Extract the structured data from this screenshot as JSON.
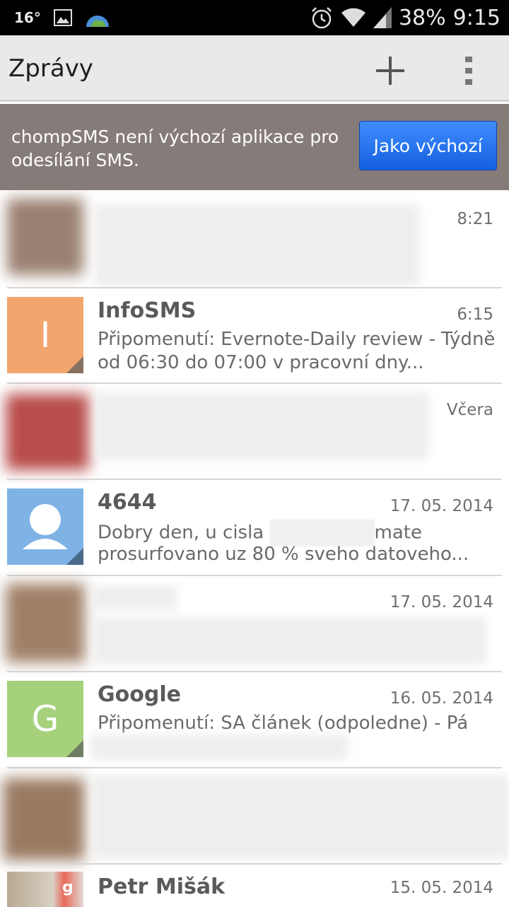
{
  "statusbar": {
    "temperature": "16°",
    "battery": "38%",
    "time": "9:15"
  },
  "actionbar": {
    "title": "Zprávy"
  },
  "banner": {
    "text": "chompSMS není výchozí aplikace pro odesílání SMS.",
    "button_label": "Jako výchozí"
  },
  "conversations": [
    {
      "name": "",
      "time": "8:21",
      "snippet": "",
      "avatar_color": "#a08070"
    },
    {
      "name": "InfoSMS",
      "time": "6:15",
      "letter": "I",
      "avatar_color": "#f2a56d",
      "snippet_line1": "Připomenutí: Evernote-Daily review - Týdně",
      "snippet_line2": "od 06:30 do 07:00 v pracovní dny..."
    },
    {
      "name": "",
      "time": "Včera",
      "snippet": "",
      "avatar_color": "#c04848"
    },
    {
      "name": "4644",
      "time": "17. 05. 2014",
      "avatar_color": "#7fb3e6",
      "snippet_line1a": "Dobry den, u cisla",
      "snippet_line1b": "mate",
      "snippet_line2": "prosurfovano uz 80 % sveho datoveho..."
    },
    {
      "name": "",
      "time": "17. 05. 2014",
      "snippet": "",
      "avatar_color": "#a0806a"
    },
    {
      "name": "Google",
      "time": "16. 05. 2014",
      "letter": "G",
      "avatar_color": "#a5d17b",
      "snippet_line1": "Připomenutí: SA článek (odpoledne) - Pá"
    },
    {
      "name": "",
      "time": "",
      "snippet": "",
      "avatar_color": "#9a7a62"
    },
    {
      "name": "Petr Mišák",
      "time": "15. 05. 2014",
      "avatar_color": "#c8b8a0"
    }
  ]
}
